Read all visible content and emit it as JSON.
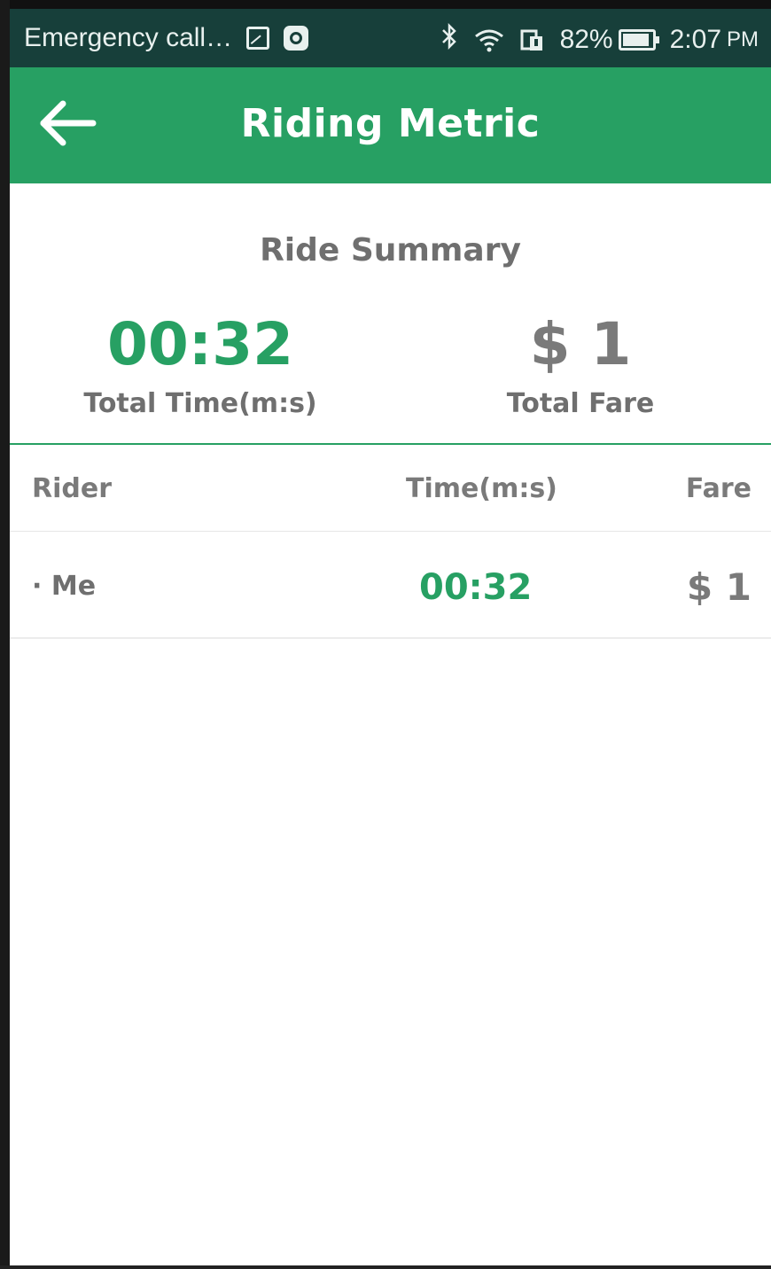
{
  "status_bar": {
    "notification_text": "Emergency call…",
    "battery_percent": "82%",
    "time": "2:07",
    "meridiem": "PM",
    "battery_level": 0.82,
    "icons": [
      "image-icon",
      "record-icon",
      "bluetooth-icon",
      "wifi-icon",
      "sim-icon",
      "battery-icon"
    ]
  },
  "app_bar": {
    "title": "Riding Metric",
    "back_icon": "arrow-left-icon"
  },
  "summary": {
    "title": "Ride Summary",
    "total_time_value": "00:32",
    "total_time_label": "Total Time(m:s)",
    "total_fare_value": "$ 1",
    "total_fare_label": "Total Fare"
  },
  "table": {
    "headers": {
      "rider": "Rider",
      "time": "Time(m:s)",
      "fare": "Fare"
    },
    "rows": [
      {
        "rider": "· Me",
        "time": "00:32",
        "fare": "$ 1"
      }
    ]
  },
  "colors": {
    "status_bar": "#173f3a",
    "primary": "#27a063",
    "text_gray": "#6f6f6f",
    "background": "#ffffff"
  }
}
